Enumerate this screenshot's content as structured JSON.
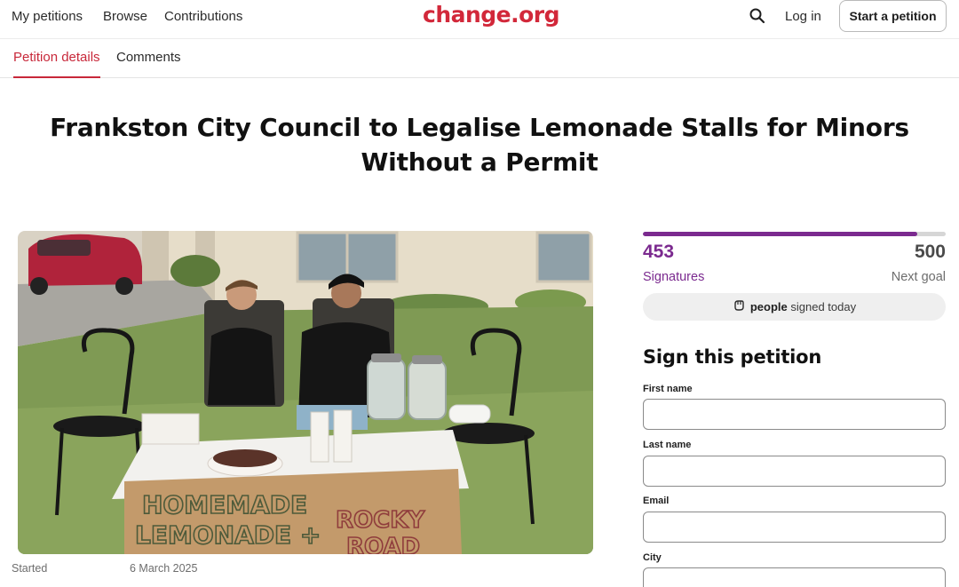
{
  "header": {
    "nav": [
      "My petitions",
      "Browse",
      "Contributions"
    ],
    "brand": "change.org",
    "login_label": "Log in",
    "start_label": "Start a petition"
  },
  "tabs": [
    {
      "label": "Petition details",
      "active": true
    },
    {
      "label": "Comments",
      "active": false
    }
  ],
  "petition": {
    "title": "Frankston City Council to Legalise Lemonade Stalls for Minors Without a Permit",
    "photo_sign_text": [
      "HOMEMADE",
      "LEMONADE +",
      "ROCKY",
      "ROAD"
    ],
    "started_label": "Started",
    "started_date": "6 March 2025"
  },
  "signatures": {
    "count": "453",
    "count_label": "Signatures",
    "goal": "500",
    "goal_label": "Next goal",
    "progress_fraction": 0.906,
    "today_bold": "people",
    "today_rest": "signed today"
  },
  "form": {
    "heading": "Sign this petition",
    "fields": [
      {
        "label": "First name",
        "value": "",
        "placeholder": ""
      },
      {
        "label": "Last name",
        "value": "",
        "placeholder": ""
      },
      {
        "label": "Email",
        "value": "",
        "placeholder": ""
      },
      {
        "label": "City",
        "value": "",
        "placeholder": ""
      }
    ]
  },
  "colors": {
    "brand_red": "#d2283a",
    "accent_purple": "#7b2a8f",
    "tab_active": "#c8283a"
  },
  "icons": [
    "search-icon",
    "fist-icon"
  ]
}
